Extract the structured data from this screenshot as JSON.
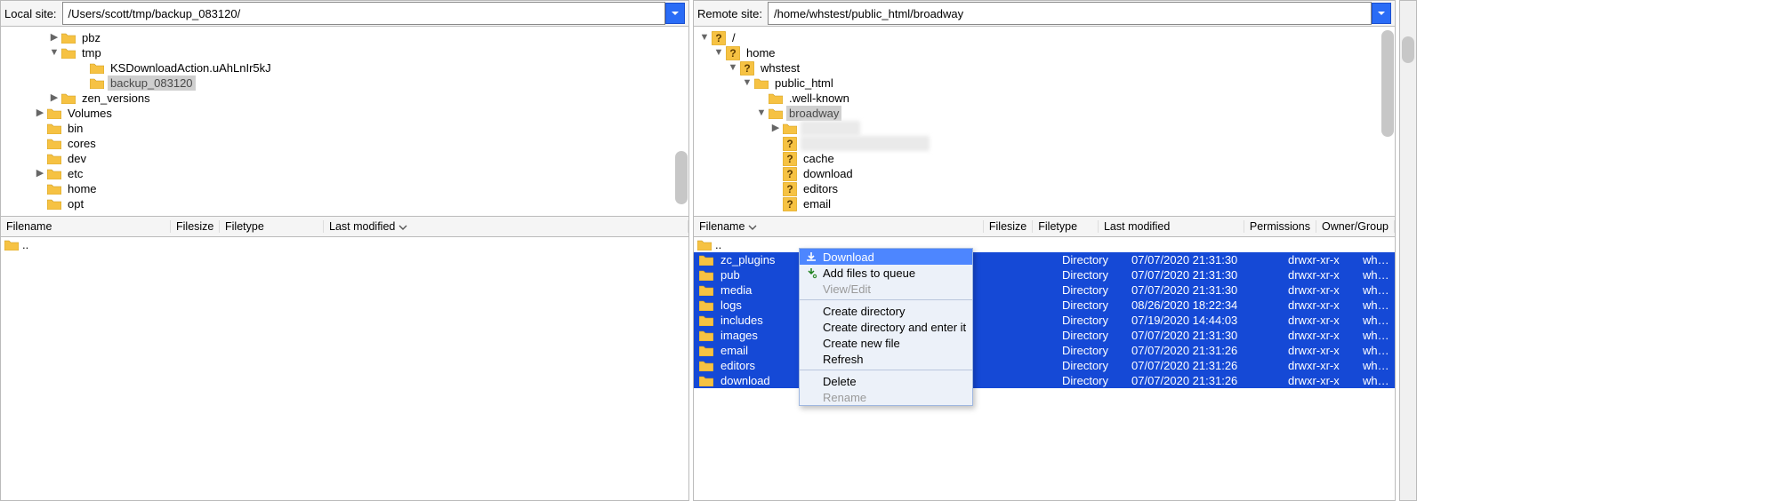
{
  "local": {
    "site_label": "Local site:",
    "path": "/Users/scott/tmp/backup_083120/",
    "tree": [
      {
        "indent": 3,
        "disc": "▶",
        "icon": "folder",
        "label": "pbz"
      },
      {
        "indent": 3,
        "disc": "▼",
        "icon": "folder",
        "label": "tmp"
      },
      {
        "indent": 5,
        "disc": "",
        "icon": "folder",
        "label": "KSDownloadAction.uAhLnIr5kJ"
      },
      {
        "indent": 5,
        "disc": "",
        "icon": "folder",
        "label": "backup_083120",
        "selected": true
      },
      {
        "indent": 3,
        "disc": "▶",
        "icon": "folder",
        "label": "zen_versions"
      },
      {
        "indent": 2,
        "disc": "▶",
        "icon": "folder",
        "label": "Volumes"
      },
      {
        "indent": 2,
        "disc": "",
        "icon": "folder",
        "label": "bin"
      },
      {
        "indent": 2,
        "disc": "",
        "icon": "folder",
        "label": "cores"
      },
      {
        "indent": 2,
        "disc": "",
        "icon": "folder",
        "label": "dev"
      },
      {
        "indent": 2,
        "disc": "▶",
        "icon": "folder",
        "label": "etc"
      },
      {
        "indent": 2,
        "disc": "",
        "icon": "folder",
        "label": "home"
      },
      {
        "indent": 2,
        "disc": "",
        "icon": "folder",
        "label": "opt"
      }
    ],
    "headers": {
      "filename": "Filename",
      "filesize": "Filesize",
      "filetype": "Filetype",
      "lastmod": "Last modified"
    },
    "list_up": ".."
  },
  "remote": {
    "site_label": "Remote site:",
    "path": "/home/whstest/public_html/broadway",
    "tree": [
      {
        "indent": 0,
        "disc": "▼",
        "icon": "qmark",
        "label": "/"
      },
      {
        "indent": 1,
        "disc": "▼",
        "icon": "qmark",
        "label": "home"
      },
      {
        "indent": 2,
        "disc": "▼",
        "icon": "qmark",
        "label": "whstest"
      },
      {
        "indent": 3,
        "disc": "▼",
        "icon": "folder",
        "label": "public_html"
      },
      {
        "indent": 4,
        "disc": "",
        "icon": "folder",
        "label": ".well-known"
      },
      {
        "indent": 4,
        "disc": "▼",
        "icon": "folder",
        "label": "broadway",
        "selected": true
      },
      {
        "indent": 5,
        "disc": "▶",
        "icon": "folder",
        "label": "",
        "blur": true
      },
      {
        "indent": 5,
        "disc": "",
        "icon": "qmark",
        "label": "",
        "blur": true,
        "wide": true
      },
      {
        "indent": 5,
        "disc": "",
        "icon": "qmark",
        "label": "cache"
      },
      {
        "indent": 5,
        "disc": "",
        "icon": "qmark",
        "label": "download"
      },
      {
        "indent": 5,
        "disc": "",
        "icon": "qmark",
        "label": "editors"
      },
      {
        "indent": 5,
        "disc": "",
        "icon": "qmark",
        "label": "email"
      }
    ],
    "headers": {
      "filename": "Filename",
      "filesize": "Filesize",
      "filetype": "Filetype",
      "lastmod": "Last modified",
      "perm": "Permissions",
      "owner": "Owner/Group"
    },
    "list_up": "..",
    "rows": [
      {
        "name": "zc_plugins",
        "type": "Directory",
        "date": "07/07/2020 21:31:30",
        "perm": "drwxr-xr-x",
        "owner": "whstest w..."
      },
      {
        "name": "pub",
        "type": "Directory",
        "date": "07/07/2020 21:31:30",
        "perm": "drwxr-xr-x",
        "owner": "whstest w..."
      },
      {
        "name": "media",
        "type": "Directory",
        "date": "07/07/2020 21:31:30",
        "perm": "drwxr-xr-x",
        "owner": "whstest w..."
      },
      {
        "name": "logs",
        "type": "Directory",
        "date": "08/26/2020 18:22:34",
        "perm": "drwxr-xr-x",
        "owner": "whstest w..."
      },
      {
        "name": "includes",
        "type": "Directory",
        "date": "07/19/2020 14:44:03",
        "perm": "drwxr-xr-x",
        "owner": "whstest w..."
      },
      {
        "name": "images",
        "type": "Directory",
        "date": "07/07/2020 21:31:30",
        "perm": "drwxr-xr-x",
        "owner": "whstest w..."
      },
      {
        "name": "email",
        "type": "Directory",
        "date": "07/07/2020 21:31:26",
        "perm": "drwxr-xr-x",
        "owner": "whstest w..."
      },
      {
        "name": "editors",
        "type": "Directory",
        "date": "07/07/2020 21:31:26",
        "perm": "drwxr-xr-x",
        "owner": "whstest w..."
      },
      {
        "name": "download",
        "type": "Directory",
        "date": "07/07/2020 21:31:26",
        "perm": "drwxr-xr-x",
        "owner": "whstest w..."
      }
    ]
  },
  "context_menu": {
    "download": "Download",
    "add_queue": "Add files to queue",
    "view_edit": "View/Edit",
    "create_dir": "Create directory",
    "create_dir_enter": "Create directory and enter it",
    "create_file": "Create new file",
    "refresh": "Refresh",
    "delete": "Delete",
    "rename": "Rename"
  },
  "colors": {
    "select_row": "#1549d6",
    "menu_hl": "#4d86ff",
    "folder": "#f6c243",
    "qmark": "#f6c243"
  }
}
